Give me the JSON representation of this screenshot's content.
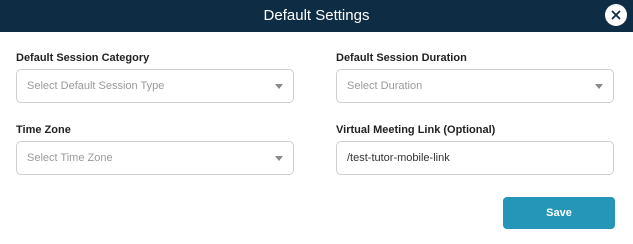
{
  "dialog": {
    "title": "Default Settings",
    "close_icon": "close-icon"
  },
  "fields": {
    "session_category": {
      "label": "Default Session Category",
      "placeholder": "Select Default Session Type"
    },
    "session_duration": {
      "label": "Default Session Duration",
      "placeholder": "Select Duration"
    },
    "time_zone": {
      "label": "Time Zone",
      "placeholder": "Select Time Zone"
    },
    "meeting_link": {
      "label": "Virtual Meeting Link (Optional)",
      "value": "/test-tutor-mobile-link"
    }
  },
  "actions": {
    "save_label": "Save"
  },
  "colors": {
    "header_bg": "#0e2d45",
    "accent": "#2596b7"
  }
}
